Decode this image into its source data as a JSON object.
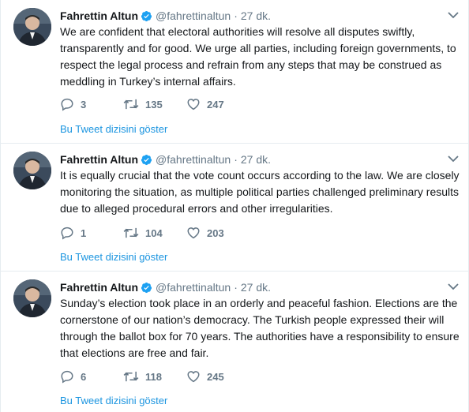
{
  "accent_color": "#1da1f2",
  "link_color": "#1b95e0",
  "tweets": [
    {
      "name": "Fahrettin Altun",
      "handle": "@fahrettinaltun",
      "dot": "·",
      "time": "27 dk.",
      "text": "We are confident that electoral authorities will resolve all disputes swiftly, transparently and for good. We urge all parties, including foreign governments, to respect the legal process and refrain from any steps that may be construed as meddling in Turkey’s internal affairs.",
      "replies": "3",
      "retweets": "135",
      "likes": "247",
      "thread_link": "Bu Tweet dizisini göster"
    },
    {
      "name": "Fahrettin Altun",
      "handle": "@fahrettinaltun",
      "dot": "·",
      "time": "27 dk.",
      "text": "It is equally crucial that the vote count occurs according to the law. We are closely monitoring the situation, as multiple political parties challenged preliminary results due to alleged procedural errors and other irregularities.",
      "replies": "1",
      "retweets": "104",
      "likes": "203",
      "thread_link": "Bu Tweet dizisini göster"
    },
    {
      "name": "Fahrettin Altun",
      "handle": "@fahrettinaltun",
      "dot": "·",
      "time": "27 dk.",
      "text": "Sunday’s election took place in an orderly and peaceful fashion. Elections are the cornerstone of our nation’s democracy. The Turkish people expressed their will through the ballot box for 70 years. The authorities have a responsibility to ensure that elections are free and fair.",
      "replies": "6",
      "retweets": "118",
      "likes": "245",
      "thread_link": "Bu Tweet dizisini göster"
    }
  ]
}
